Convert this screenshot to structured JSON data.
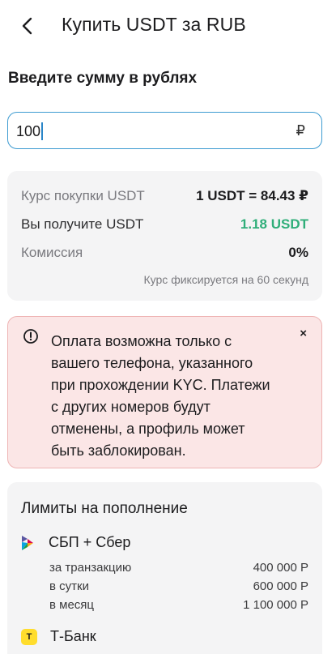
{
  "header": {
    "title": "Купить USDT за RUB",
    "back_icon": "chevron-left-icon"
  },
  "amount": {
    "label": "Введите сумму в рублях",
    "value": "100",
    "currency_symbol": "₽"
  },
  "rate": {
    "buy_label": "Курс покупки USDT",
    "buy_value": "1 USDT = 84.43 ₽",
    "receive_label": "Вы получите USDT",
    "receive_value": "1.18 USDT",
    "fee_label": "Комиссия",
    "fee_value": "0%",
    "note": "Курс фиксируется на 60 секунд"
  },
  "alert": {
    "icon": "info-circle-icon",
    "text": "Оплата возможна только с\nвашего телефона, указанного\nпри прохождении KYC. Платежи\nс других номеров будут\nотменены, а профиль может\nбыть заблокирован.",
    "close_label": "×"
  },
  "limits": {
    "title": "Лимиты на пополнение",
    "banks": [
      {
        "name": "СБП + Сбер",
        "icon": "sbp-logo-icon",
        "rows": [
          {
            "label": "за транзакцию",
            "value": "400 000 Р"
          },
          {
            "label": "в сутки",
            "value": "600 000 Р"
          },
          {
            "label": "в месяц",
            "value": "1 100 000 Р"
          }
        ]
      },
      {
        "name": "Т-Банк",
        "icon": "tbank-logo-icon",
        "logo_text": "T"
      }
    ]
  },
  "colors": {
    "accent": "#3d9bd1",
    "success": "#2fae79",
    "alert_bg": "#fbe6e6",
    "alert_border": "#eeb4b4",
    "card_bg": "#f4f4f5",
    "tbank_yellow": "#ffdd2d"
  }
}
